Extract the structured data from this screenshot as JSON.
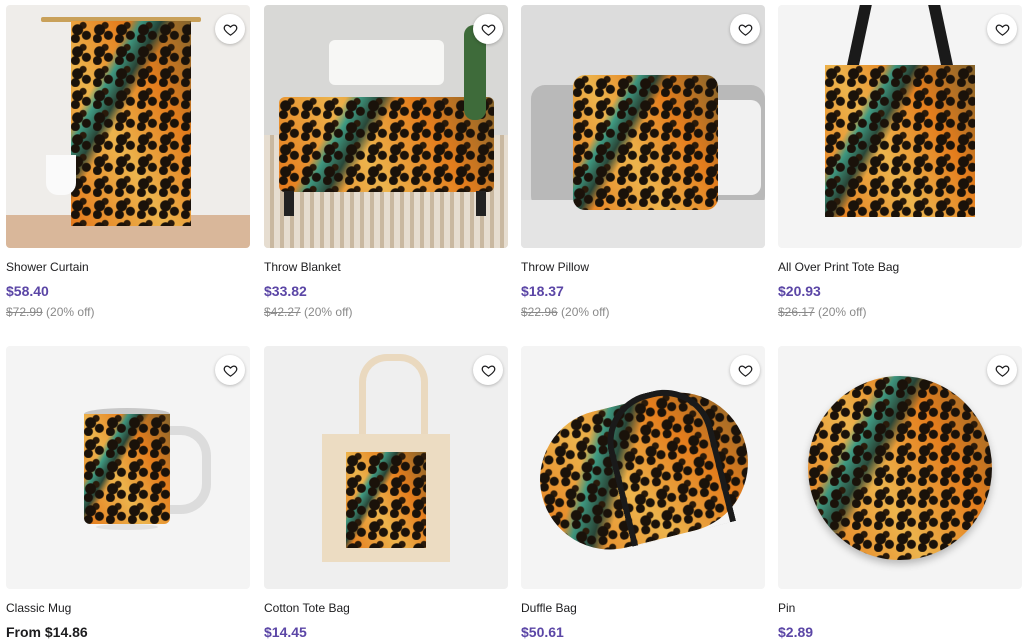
{
  "products": [
    {
      "title": "Shower Curtain",
      "price": "$58.40",
      "original_price": "$72.99",
      "discount": "(20% off)",
      "image": "shower-curtain-image"
    },
    {
      "title": "Throw Blanket",
      "price": "$33.82",
      "original_price": "$42.27",
      "discount": "(20% off)",
      "image": "throw-blanket-image"
    },
    {
      "title": "Throw Pillow",
      "price": "$18.37",
      "original_price": "$22.96",
      "discount": "(20% off)",
      "image": "throw-pillow-image"
    },
    {
      "title": "All Over Print Tote Bag",
      "price": "$20.93",
      "original_price": "$26.17",
      "discount": "(20% off)",
      "image": "all-over-print-tote-bag-image"
    },
    {
      "title": "Classic Mug",
      "price": "From $14.86",
      "image": "classic-mug-image"
    },
    {
      "title": "Cotton Tote Bag",
      "price": "$14.45",
      "image": "cotton-tote-bag-image"
    },
    {
      "title": "Duffle Bag",
      "price": "$50.61",
      "image": "duffle-bag-image"
    },
    {
      "title": "Pin",
      "price": "$2.89",
      "image": "pin-image"
    }
  ],
  "icons": {
    "favorite": "heart-icon"
  },
  "colors": {
    "price": "#5b46a6",
    "price_dark": "#1d1d1f",
    "strike": "#8a8a8a"
  }
}
